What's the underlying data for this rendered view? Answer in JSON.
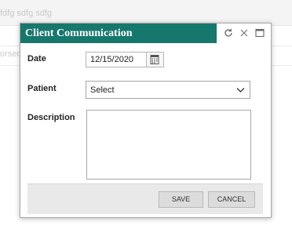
{
  "background": {
    "row1_text": "fdfg sdfg sdfg",
    "row2_text": "orsen"
  },
  "dialog": {
    "title": "Client Communication",
    "titlebar_color": "#16776d",
    "icons": [
      "refresh-icon",
      "close-icon",
      "maximize-icon"
    ],
    "fields": {
      "date_label": "Date",
      "date_value": "12/15/2020",
      "patient_label": "Patient",
      "patient_value": "Select",
      "description_label": "Description",
      "description_value": ""
    },
    "buttons": {
      "save": "SAVE",
      "cancel": "CANCEL"
    }
  }
}
